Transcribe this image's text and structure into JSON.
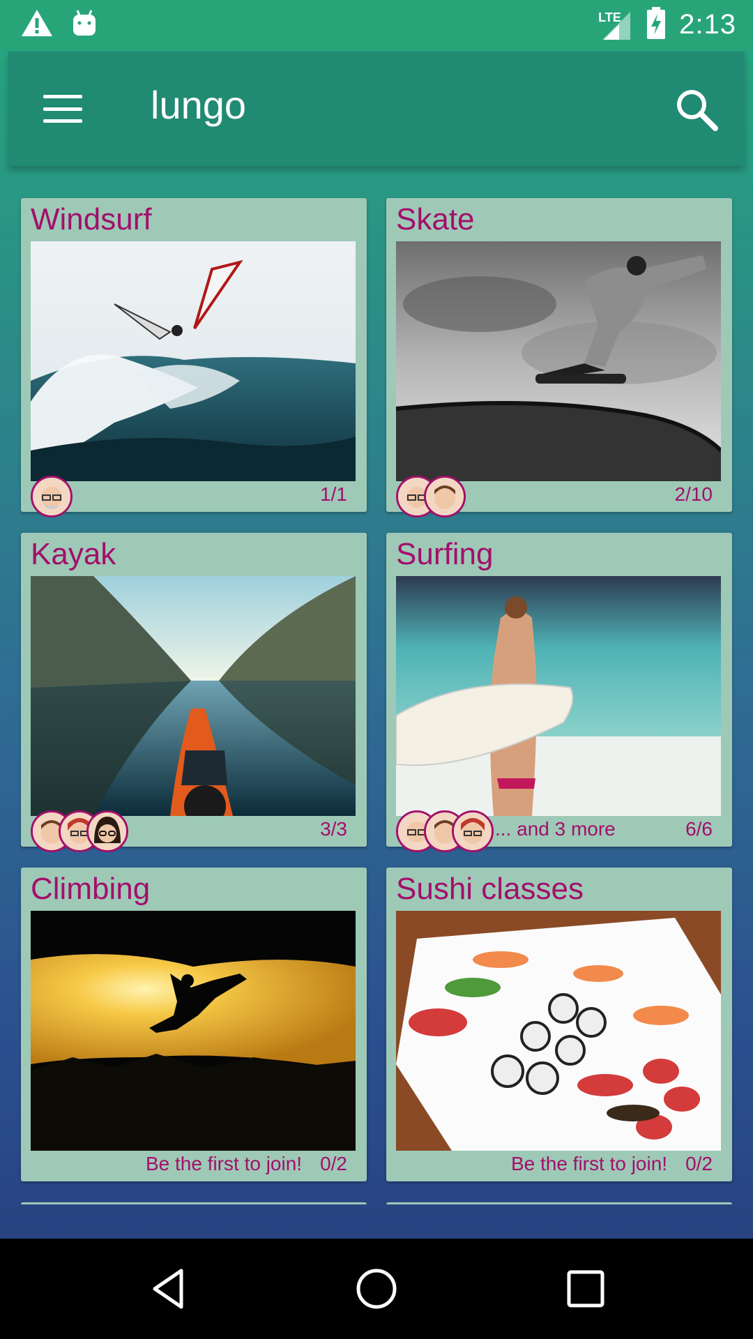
{
  "status_bar": {
    "time": "2:13",
    "network": "LTE",
    "icons": [
      "warning-icon",
      "android-icon",
      "signal-icon",
      "battery-charging-icon"
    ]
  },
  "app_bar": {
    "title": "lungo",
    "menu_icon": "menu-icon",
    "search_icon": "search-icon"
  },
  "activities": [
    {
      "title": "Windsurf",
      "count": "1/1",
      "avatars": 1,
      "more": "",
      "join": ""
    },
    {
      "title": "Skate",
      "count": "2/10",
      "avatars": 2,
      "more": "",
      "join": ""
    },
    {
      "title": "Kayak",
      "count": "3/3",
      "avatars": 3,
      "more": "",
      "join": ""
    },
    {
      "title": "Surfing",
      "count": "6/6",
      "avatars": 3,
      "more": "... and 3 more",
      "join": ""
    },
    {
      "title": "Climbing",
      "count": "0/2",
      "avatars": 0,
      "more": "",
      "join": "Be the first to join!"
    },
    {
      "title": "Sushi classes",
      "count": "0/2",
      "avatars": 0,
      "more": "",
      "join": "Be the first to join!"
    }
  ],
  "nav_bar": {
    "back_icon": "back-icon",
    "home_icon": "home-icon",
    "recents_icon": "recents-icon"
  },
  "colors": {
    "accent": "#a30f6b",
    "card": "#9ec9b7",
    "app_bar": "#218a73"
  }
}
